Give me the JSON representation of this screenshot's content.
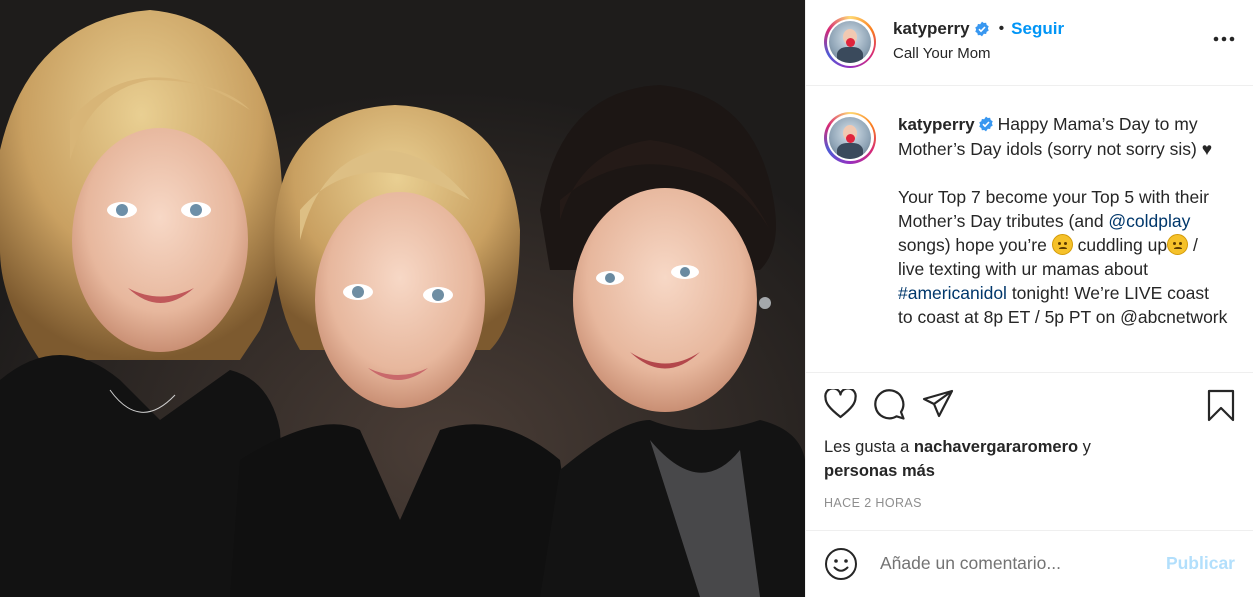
{
  "post": {
    "photo_alt": "",
    "header": {
      "username": "katyperry",
      "follow_label": "Seguir",
      "dot": "•",
      "location": "Call Your Mom",
      "more_icon": "more-options-icon"
    },
    "caption": {
      "username": "katyperry",
      "line1": "Happy Mama’s Day to my Mother’s Day idols (sorry not sorry sis) ♥",
      "para2_a": "Your Top 7 become your Top 5 with their Mother’s Day tributes (and ",
      "mention_coldplay": "@coldplay",
      "para2_b": " songs) hope you’re ",
      "para2_c": " cuddling up",
      "para2_d": " / live texting with ur mamas about ",
      "hashtag": "#americanidol",
      "para2_e": " tonight! We’re LIVE coast to coast at 8p ET / 5p PT on @abcnetwork"
    },
    "actions": {
      "like_icon": "heart-icon",
      "comment_icon": "comment-icon",
      "share_icon": "share-icon",
      "save_icon": "bookmark-icon"
    },
    "likes": {
      "prefix": "Les gusta a ",
      "user": "nachavergararomero",
      "middle": " y",
      "others": "personas más"
    },
    "time": "HACE 2 HORAS",
    "comment_box": {
      "emoji_icon": "smiley-icon",
      "placeholder": "Añade un comentario...",
      "publish_label": "Publicar"
    },
    "colors": {
      "accent": "#0095f6",
      "publish_disabled": "#b2dffc",
      "link": "#00376b"
    }
  }
}
